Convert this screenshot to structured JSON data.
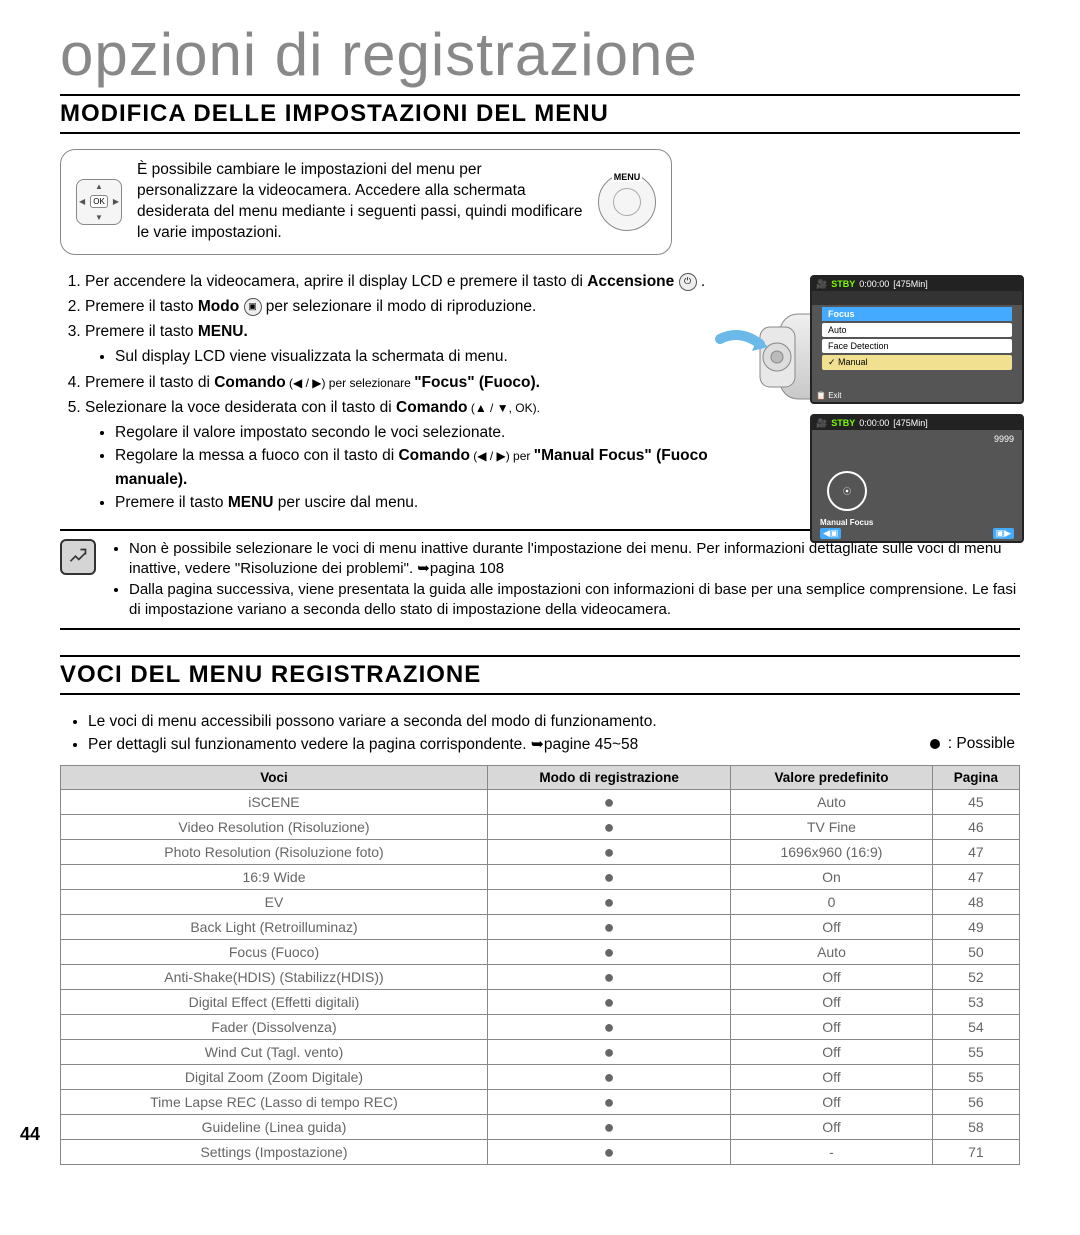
{
  "page": {
    "number": "44",
    "title": "opzioni di registrazione"
  },
  "section1": {
    "heading": "MODIFICA DELLE IMPOSTAZIONI DEL MENU",
    "intro": "È possibile cambiare le impostazioni del menu per personalizzare la videocamera. Accedere alla schermata desiderata del menu mediante i seguenti passi, quindi modificare le varie impostazioni.",
    "menu_btn": "MENU",
    "ok_btn": "OK",
    "steps": {
      "s1a": "Per accendere la videocamera, aprire il display LCD e premere il tasto di ",
      "s1b": "Accensione",
      "s1c": " .",
      "s2a": "Premere il tasto ",
      "s2b": "Modo",
      "s2c": " per selezionare il modo di riproduzione.",
      "s3a": "Premere il tasto ",
      "s3b": "MENU.",
      "s3_1": "Sul display LCD viene visualizzata la schermata di menu.",
      "s4a": "Premere il tasto di ",
      "s4b": "Comando",
      "s4c": " (◀ / ▶) per selezionare ",
      "s4d": "\"Focus\" (Fuoco).",
      "s5a": "Selezionare la voce desiderata con il tasto di ",
      "s5b": "Comando",
      "s5c": " (▲ / ▼, OK).",
      "s5_1": "Regolare il valore impostato secondo le voci selezionate.",
      "s5_2a": "Regolare la messa a fuoco con il tasto di ",
      "s5_2b": "Comando",
      "s5_2c": " (◀ / ▶) per ",
      "s5_2d": "\"Manual Focus\" (Fuoco manuale).",
      "s5_3a": "Premere il tasto ",
      "s5_3b": "MENU",
      "s5_3c": " per uscire dal menu."
    },
    "screen1": {
      "stby": "STBY",
      "time": "0:00:00",
      "remain": "[475Min]",
      "focus": "Focus",
      "auto": "Auto",
      "face": "Face Detection",
      "manual": "Manual",
      "exit": "Exit"
    },
    "screen2": {
      "stby": "STBY",
      "time": "0:00:00",
      "remain": "[475Min]",
      "count": "9999",
      "mf": "Manual Focus"
    },
    "notes": {
      "n1": "Non è possibile selezionare le voci di menu inattive durante l'impostazione dei menu. Per informazioni dettagliate sulle voci di menu inattive, vedere \"Risoluzione dei problemi\". ➥pagina 108",
      "n2": "Dalla pagina successiva, viene presentata la guida alle impostazioni con informazioni di base per una semplice comprensione. Le fasi di impostazione variano a seconda dello stato di impostazione della videocamera."
    }
  },
  "section2": {
    "heading": "VOCI DEL MENU REGISTRAZIONE",
    "intro1": "Le voci di menu accessibili possono variare a seconda del modo di funzionamento.",
    "intro2": "Per dettagli sul funzionamento vedere la pagina corrispondente. ➥pagine 45~58",
    "legend": ": Possible",
    "table": {
      "headers": [
        "Voci",
        "Modo di registrazione",
        "Valore predefinito",
        "Pagina"
      ],
      "rows": [
        [
          "iSCENE",
          "●",
          "Auto",
          "45"
        ],
        [
          "Video Resolution (Risoluzione)",
          "●",
          "TV Fine",
          "46"
        ],
        [
          "Photo Resolution (Risoluzione foto)",
          "●",
          "1696x960 (16:9)",
          "47"
        ],
        [
          "16:9 Wide",
          "●",
          "On",
          "47"
        ],
        [
          "EV",
          "●",
          "0",
          "48"
        ],
        [
          "Back Light (Retroilluminaz)",
          "●",
          "Off",
          "49"
        ],
        [
          "Focus (Fuoco)",
          "●",
          "Auto",
          "50"
        ],
        [
          "Anti-Shake(HDIS) (Stabilizz(HDIS))",
          "●",
          "Off",
          "52"
        ],
        [
          "Digital Effect (Effetti digitali)",
          "●",
          "Off",
          "53"
        ],
        [
          "Fader (Dissolvenza)",
          "●",
          "Off",
          "54"
        ],
        [
          "Wind Cut (Tagl. vento)",
          "●",
          "Off",
          "55"
        ],
        [
          "Digital Zoom (Zoom Digitale)",
          "●",
          "Off",
          "55"
        ],
        [
          "Time Lapse REC (Lasso di tempo REC)",
          "●",
          "Off",
          "56"
        ],
        [
          "Guideline (Linea guida)",
          "●",
          "Off",
          "58"
        ],
        [
          "Settings (Impostazione)",
          "●",
          "-",
          "71"
        ]
      ]
    }
  }
}
